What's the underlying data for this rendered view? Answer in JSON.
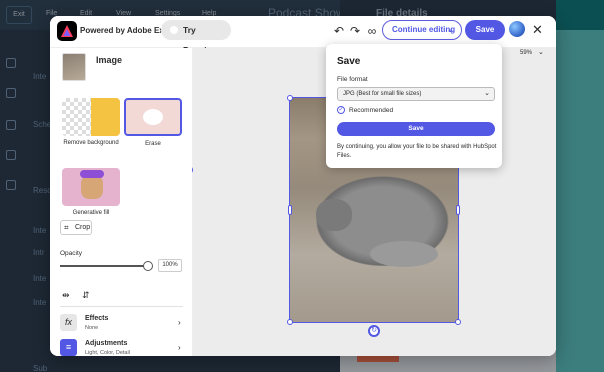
{
  "background": {
    "exit_label": "Exit",
    "menus": [
      "File",
      "Edit",
      "View",
      "Settings",
      "Help"
    ],
    "post_title": "Podcast Show N",
    "details_title": "File details",
    "sidebar_texts": [
      "Inte",
      "Sche",
      "Reso",
      "Inte",
      "Intr",
      "Inte",
      "Inte",
      "Sub"
    ],
    "teal_color": "#00a4a0"
  },
  "header": {
    "powered_by": "Powered by Adobe Express",
    "try_premium": "Try Premium",
    "continue_editing": "Continue editing",
    "save": "Save"
  },
  "panel": {
    "title": "Image",
    "tools": [
      {
        "label": "Remove background"
      },
      {
        "label": "Erase"
      },
      {
        "label": "Generative fill"
      }
    ],
    "crop": "Crop",
    "opacity_label": "Opacity",
    "opacity_value": "100%",
    "opacity": 1.0,
    "rows": [
      {
        "title": "Effects",
        "subtitle": "None",
        "icon": "fx-icon"
      },
      {
        "title": "Adjustments",
        "subtitle": "Light, Color, Detail",
        "icon": "sliders-icon"
      }
    ]
  },
  "canvas": {
    "zoom": "59%"
  },
  "save_popover": {
    "title": "Save",
    "format_label": "File format",
    "format_value": "JPG (Best for small file sizes)",
    "recommended": "Recommended",
    "save_button": "Save",
    "note": "By continuing, you allow your file to be shared with HubSpot Files."
  },
  "colors": {
    "accent": "#5258e4"
  }
}
